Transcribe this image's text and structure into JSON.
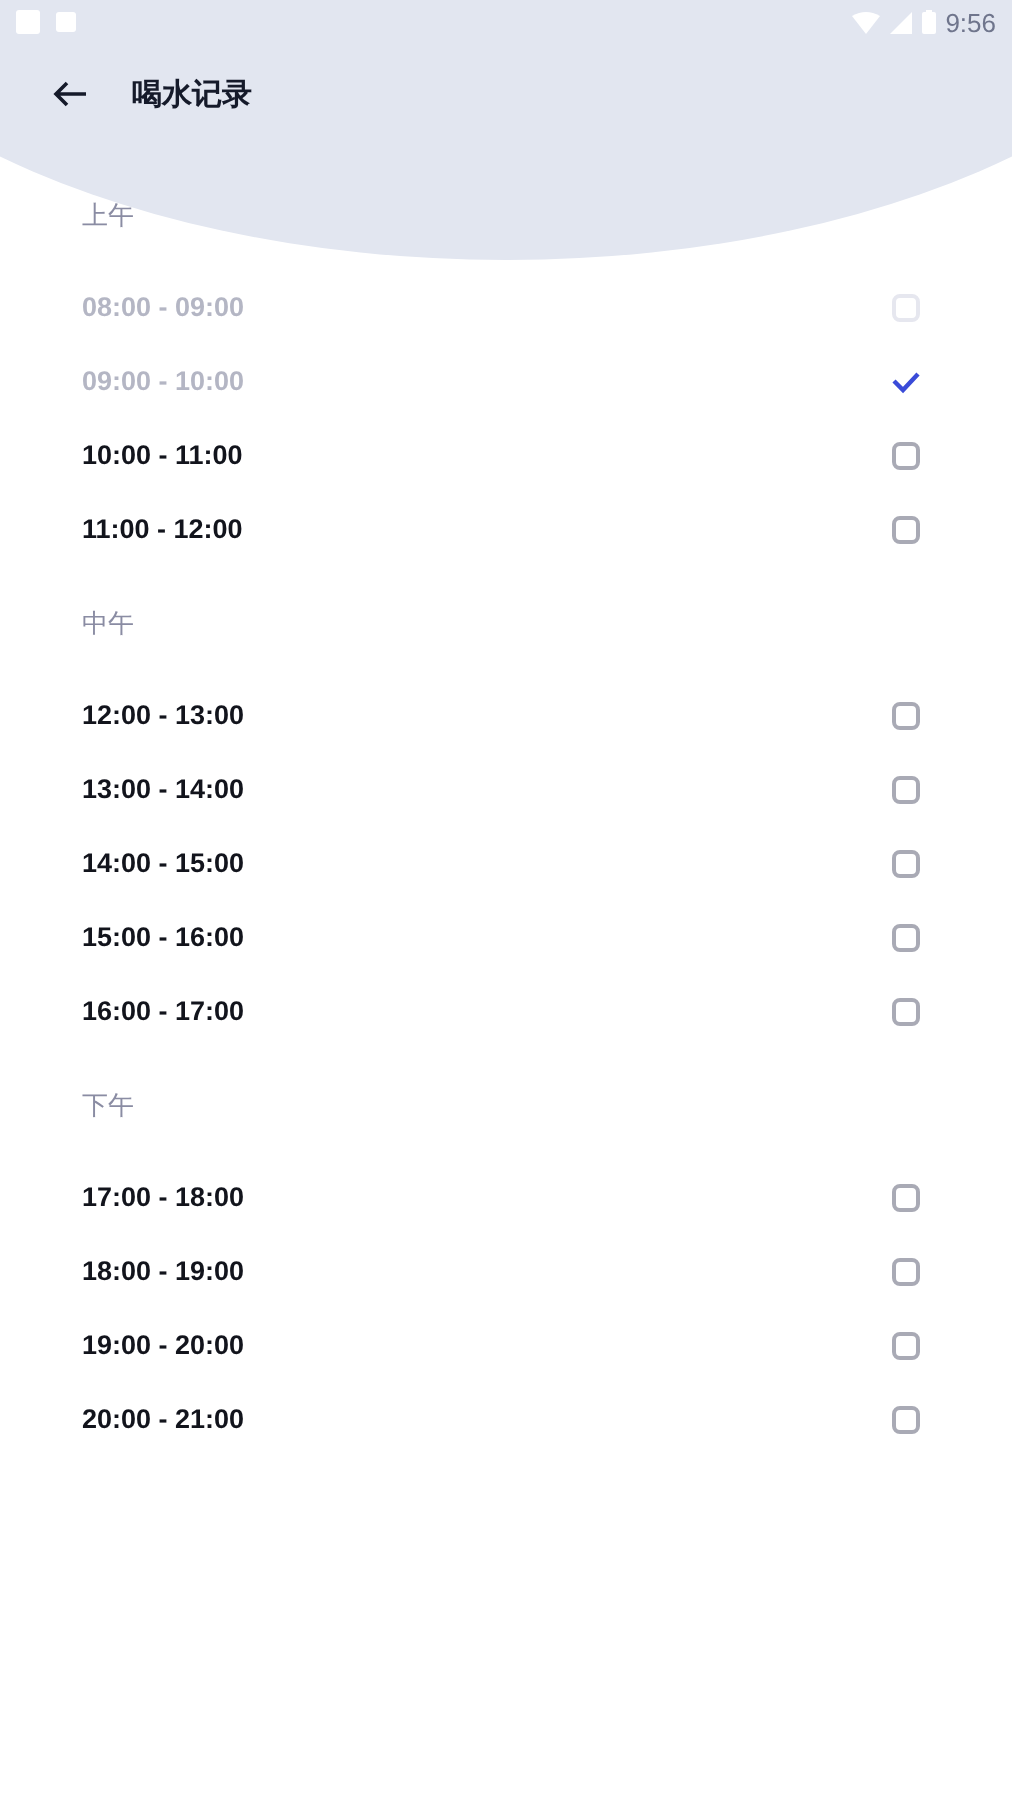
{
  "status_bar": {
    "time": "9:56"
  },
  "header": {
    "title": "喝水记录"
  },
  "sections": [
    {
      "label": "上午",
      "slots": [
        {
          "time": "08:00 - 09:00",
          "disabled": true,
          "checked": false
        },
        {
          "time": "09:00 - 10:00",
          "disabled": true,
          "checked": true
        },
        {
          "time": "10:00 - 11:00",
          "disabled": false,
          "checked": false
        },
        {
          "time": "11:00 - 12:00",
          "disabled": false,
          "checked": false
        }
      ]
    },
    {
      "label": "中午",
      "slots": [
        {
          "time": "12:00 - 13:00",
          "disabled": false,
          "checked": false
        },
        {
          "time": "13:00 - 14:00",
          "disabled": false,
          "checked": false
        },
        {
          "time": "14:00 - 15:00",
          "disabled": false,
          "checked": false
        },
        {
          "time": "15:00 - 16:00",
          "disabled": false,
          "checked": false
        },
        {
          "time": "16:00 - 17:00",
          "disabled": false,
          "checked": false
        }
      ]
    },
    {
      "label": "下午",
      "slots": [
        {
          "time": "17:00 - 18:00",
          "disabled": false,
          "checked": false
        },
        {
          "time": "18:00 - 19:00",
          "disabled": false,
          "checked": false
        },
        {
          "time": "19:00 - 20:00",
          "disabled": false,
          "checked": false
        },
        {
          "time": "20:00 - 21:00",
          "disabled": false,
          "checked": false
        }
      ]
    }
  ]
}
